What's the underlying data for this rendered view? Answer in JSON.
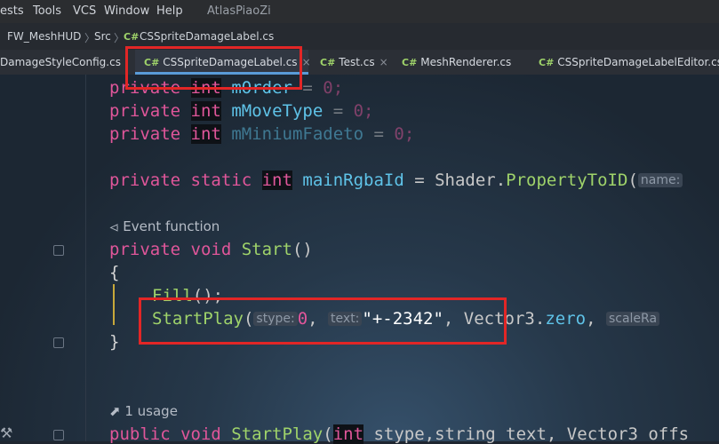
{
  "menu": {
    "items": [
      "ests",
      "Tools",
      "VCS",
      "Window",
      "Help"
    ],
    "project": "AtlasPiaoZi"
  },
  "breadcrumb": {
    "project": "FW_MeshHUD",
    "folder": "Src",
    "file_prefix": "C#",
    "file": "CSSpriteDamageLabel.cs"
  },
  "tabs": [
    {
      "label": "DamageStyleConfig.cs",
      "prefix": "",
      "close": "×"
    },
    {
      "label": "CSSpriteDamageLabel.cs",
      "prefix": "C#",
      "close": "×"
    },
    {
      "label": "Test.cs",
      "prefix": "C#",
      "close": "×"
    },
    {
      "label": "MeshRenderer.cs",
      "prefix": "C#",
      "close": ""
    },
    {
      "label": "CSSpriteDamageLabelEditor.cs",
      "prefix": "C#",
      "close": ""
    }
  ],
  "code": {
    "l1": {
      "kw": "private",
      "ty": "int",
      "name": "mOrder",
      "rest": " = ",
      "val": "0",
      "end": ";"
    },
    "l2": {
      "kw": "private",
      "ty": "int",
      "name": "mMoveType",
      "rest": " = ",
      "val": "0",
      "end": ";"
    },
    "l3": {
      "kw": "private",
      "ty": "int",
      "name": "mMiniumFadeto",
      "rest": " = ",
      "val": "0",
      "end": ";"
    },
    "l4": {
      "kw": "private static",
      "ty": "int",
      "name": "mainRgbaId",
      "rest": " = Shader.",
      "call": "PropertyToID",
      "paren": "(",
      "hint": "name:"
    },
    "event_label": "Event function",
    "l5": {
      "kw": "private void",
      "name": "Start",
      "rest": "()"
    },
    "brace_open": "{",
    "l6": {
      "call": "Fill",
      "rest": "();"
    },
    "l7": {
      "call": "StartPlay",
      "paren": "(",
      "hint1": "stype:",
      "v1": "0",
      "sep1": ", ",
      "hint2": "text:",
      "v2": "\"+-2342\"",
      "sep2": ", Vector3.",
      "v3": "zero",
      "sep3": ", ",
      "hint3": "scaleRa"
    },
    "brace_close": "}",
    "usage_label": "1 usage",
    "l8": {
      "kw": "public void",
      "call": "StartPlay",
      "paren": "(",
      "ty": "int",
      "rest": " stype,string text, Vector3 offs"
    }
  }
}
